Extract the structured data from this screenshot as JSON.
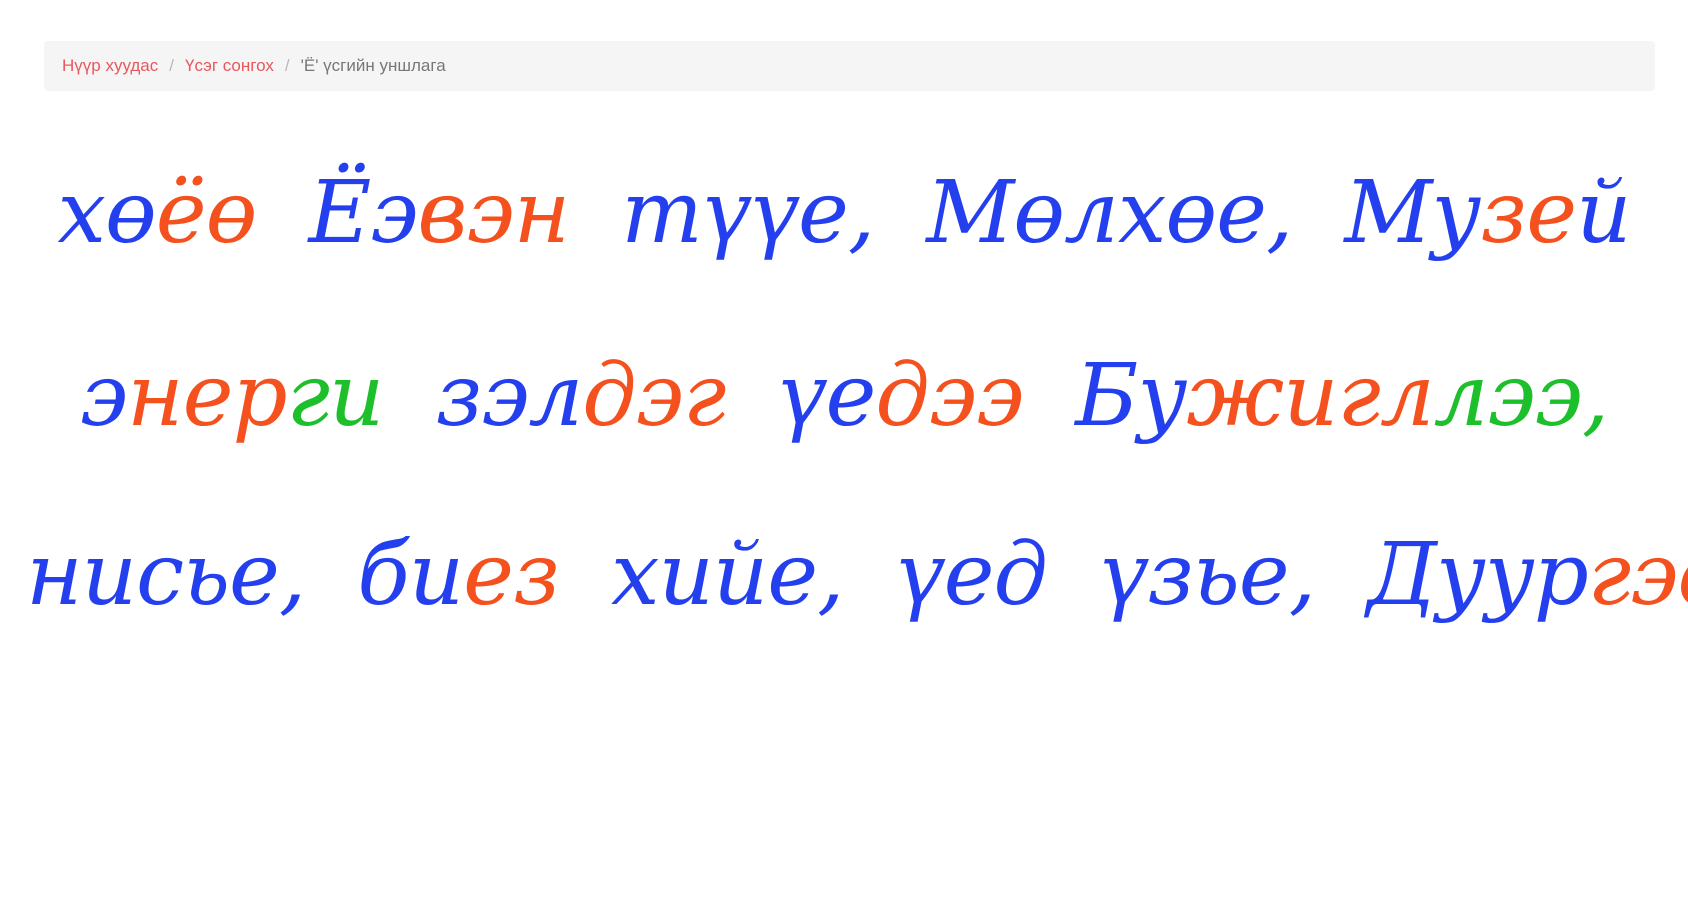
{
  "breadcrumb": {
    "home": "Нүүр хуудас",
    "section": "Үсэг сонгох",
    "current": "'Ё' үсгийн уншлага",
    "separator": "/"
  },
  "colors": {
    "blue": "#2440ee",
    "orange": "#f4511e",
    "green": "#1dbf2a",
    "breadcrumb_link": "#e8575d",
    "breadcrumb_current": "#777777"
  },
  "lines": [
    {
      "words": [
        {
          "segments": [
            {
              "text": "хө",
              "color": "blue"
            },
            {
              "text": "ёө",
              "color": "orange"
            }
          ]
        },
        {
          "segments": [
            {
              "text": "Ёэ",
              "color": "blue"
            },
            {
              "text": "вэн",
              "color": "orange"
            }
          ]
        },
        {
          "segments": [
            {
              "text": "түүе,",
              "color": "blue"
            }
          ]
        },
        {
          "segments": [
            {
              "text": "Мөлхөе,",
              "color": "blue"
            }
          ]
        },
        {
          "segments": [
            {
              "text": "Му",
              "color": "blue"
            },
            {
              "text": "зе",
              "color": "orange"
            },
            {
              "text": "й",
              "color": "blue"
            }
          ]
        }
      ]
    },
    {
      "words": [
        {
          "segments": [
            {
              "text": "э",
              "color": "blue"
            },
            {
              "text": "нер",
              "color": "orange"
            },
            {
              "text": "ги",
              "color": "green"
            }
          ]
        },
        {
          "segments": [
            {
              "text": "зэл",
              "color": "blue"
            },
            {
              "text": "дэг",
              "color": "orange"
            }
          ]
        },
        {
          "segments": [
            {
              "text": "үе",
              "color": "blue"
            },
            {
              "text": "дээ",
              "color": "orange"
            }
          ]
        },
        {
          "segments": [
            {
              "text": "Бу",
              "color": "blue"
            },
            {
              "text": "жигл",
              "color": "orange"
            },
            {
              "text": "лэ",
              "color": "green"
            },
            {
              "text": "э,",
              "color": "green"
            }
          ]
        }
      ]
    },
    {
      "words": [
        {
          "segments": [
            {
              "text": "нисье,",
              "color": "blue"
            }
          ]
        },
        {
          "segments": [
            {
              "text": "би",
              "color": "blue"
            },
            {
              "text": "ез",
              "color": "orange"
            }
          ]
        },
        {
          "segments": [
            {
              "text": "хийе,",
              "color": "blue"
            }
          ]
        },
        {
          "segments": [
            {
              "text": "үед",
              "color": "blue"
            }
          ]
        },
        {
          "segments": [
            {
              "text": "үзье,",
              "color": "blue"
            }
          ]
        },
        {
          "segments": [
            {
              "text": "Дуур",
              "color": "blue"
            },
            {
              "text": "гэе",
              "color": "orange"
            }
          ]
        }
      ]
    }
  ]
}
